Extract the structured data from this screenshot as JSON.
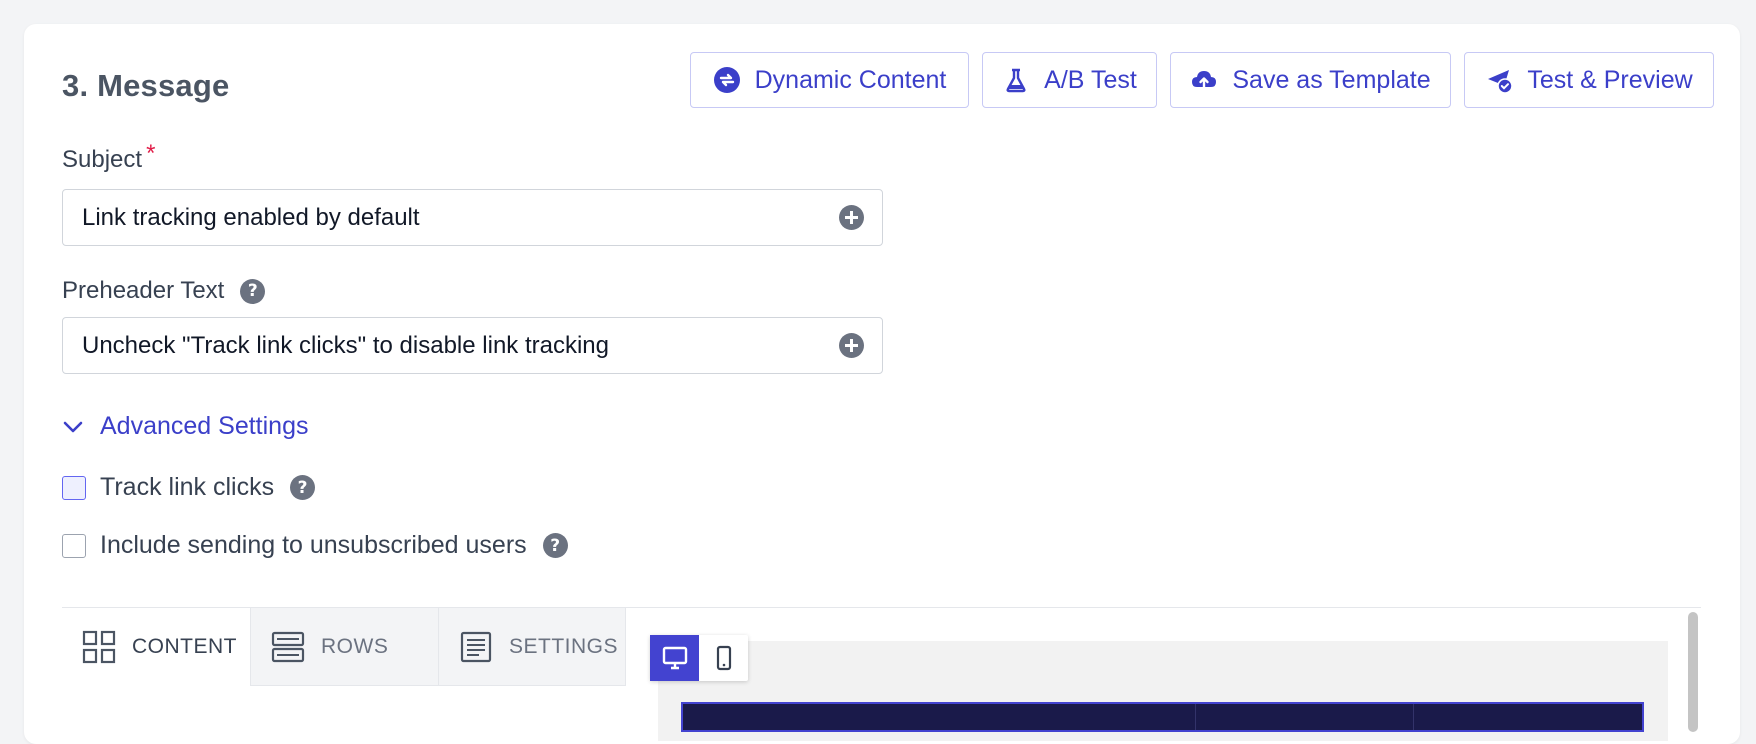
{
  "section": {
    "title": "3. Message"
  },
  "toolbar": {
    "dynamic_content": "Dynamic Content",
    "ab_test": "A/B Test",
    "save_template": "Save as Template",
    "test_preview": "Test & Preview"
  },
  "subject": {
    "label": "Subject",
    "required_mark": "*",
    "value": "Link tracking enabled by default"
  },
  "preheader": {
    "label": "Preheader Text",
    "value": "Uncheck \"Track link clicks\" to disable link tracking"
  },
  "advanced": {
    "label": "Advanced Settings",
    "expanded": true
  },
  "options": {
    "track_clicks": {
      "label": "Track link clicks",
      "checked": false
    },
    "unsubscribed": {
      "label": "Include sending to unsubscribed users",
      "checked": false
    }
  },
  "editor": {
    "tabs": [
      {
        "label": "CONTENT",
        "icon": "grid-icon",
        "active": true
      },
      {
        "label": "ROWS",
        "icon": "rows-icon",
        "active": false
      },
      {
        "label": "SETTINGS",
        "icon": "settings-doc-icon",
        "active": false
      }
    ],
    "device": {
      "selected": "desktop"
    }
  },
  "colors": {
    "accent": "#3b3fc9",
    "required": "#e11d48",
    "device_active": "#4343d0",
    "canvas": "#1a1a4a"
  }
}
